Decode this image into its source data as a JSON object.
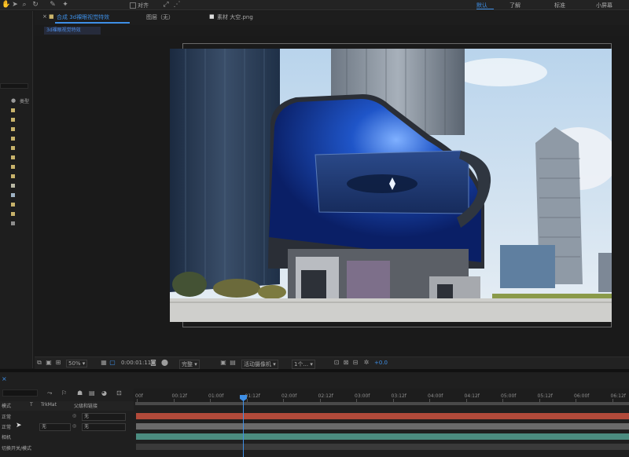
{
  "toolbar": {
    "tool_icons": [
      "hand-icon",
      "selection-arrow-icon",
      "zoom-icon",
      "rotate-icon",
      "pen-icon",
      "brush-icon",
      "puppet-pin-icon"
    ],
    "align_label": "对齐",
    "workspaces": [
      "默认",
      "了解",
      "标准",
      "小屏幕"
    ],
    "active_workspace": "默认"
  },
  "project_panel": {
    "column_header": "类型",
    "swatch_colors": [
      "#c7b26b",
      "#c7b26b",
      "#c7b26b",
      "#c7b26b",
      "#c7b26b",
      "#c7b26b",
      "#c7b26b",
      "#c7b26b",
      "#b8b7a3",
      "#9fb3c4",
      "#c7b26b",
      "#c7b26b",
      "#8d8d8d"
    ]
  },
  "tabs": [
    {
      "label": "合成 3d裸眼视觉特效",
      "active": true
    },
    {
      "label": "图层（无）",
      "active": false
    },
    {
      "label": "素材 大空.png",
      "active": false
    }
  ],
  "subtab": "3d裸眼视觉特效",
  "viewer_bar": {
    "zoom": "50%",
    "timecode": "0:00:01:11",
    "resolution": "完整",
    "camera": "活动摄像机",
    "views": "1个...",
    "exposure": "+0.0"
  },
  "timeline": {
    "ruler_labels": [
      "00f",
      "00:12f",
      "01:00f",
      "01:12f",
      "02:00f",
      "02:12f",
      "03:00f",
      "03:12f",
      "04:00f",
      "04:12f",
      "05:00f",
      "05:12f",
      "06:00f",
      "06:12f"
    ],
    "header": {
      "mode": "模式",
      "t": "T",
      "trkmat": "TrkMat",
      "parent": "父级和链接"
    },
    "rows": [
      {
        "mode": "正常",
        "trkmat": "",
        "parent": "无"
      },
      {
        "mode": "正常",
        "trkmat": "无",
        "parent": "无"
      },
      {
        "mode": "相机",
        "trkmat": "",
        "parent": ""
      }
    ],
    "switches_label": "切换开关/模式",
    "colors": {
      "bar_top": "#b14a3a",
      "bar_mid": "#6a6a6a",
      "bar_low": "#4b8c80",
      "bar_bottom": "#3a3a3a"
    }
  },
  "accent_color": "#3e8fe6"
}
